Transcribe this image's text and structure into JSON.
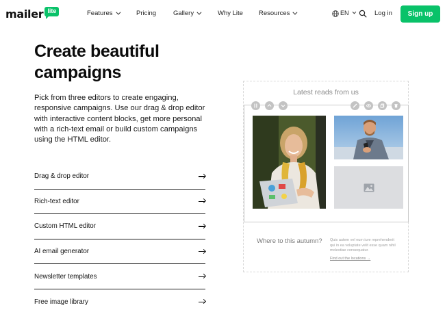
{
  "nav": {
    "logo_text": "mailer",
    "logo_badge": "lite",
    "items": [
      {
        "label": "Features",
        "has_dropdown": true
      },
      {
        "label": "Pricing",
        "has_dropdown": false
      },
      {
        "label": "Gallery",
        "has_dropdown": true
      },
      {
        "label": "Why Lite",
        "has_dropdown": false
      },
      {
        "label": "Resources",
        "has_dropdown": true
      }
    ],
    "language": "EN",
    "login_label": "Log in",
    "signup_label": "Sign up"
  },
  "hero": {
    "title": "Create beautiful campaigns",
    "description": "Pick from three editors to create engaging, responsive campaigns. Use our drag & drop editor with interactive content blocks, get more personal with a rich-text email or build custom campaigns using the HTML editor."
  },
  "features": [
    "Drag & drop editor",
    "Rich-text editor",
    "Custom HTML editor",
    "AI email generator",
    "Newsletter templates",
    "Free image library"
  ],
  "preview": {
    "heading": "Latest reads from us",
    "toolbar_left": [
      "drag-handle-icon",
      "move-up-icon",
      "move-down-icon"
    ],
    "toolbar_right": [
      "edit-icon",
      "preview-eye-icon",
      "duplicate-icon",
      "delete-icon"
    ],
    "teaser_title": "Where to this autumn?",
    "teaser_body": "Quis autem vel eum iure reprehenderit qui in ea voluptate velit esse quam nihil molestiae consequatur.",
    "teaser_link": "Find out the locations →"
  },
  "colors": {
    "brand_green": "#09c269",
    "text": "#0b0b0b",
    "muted": "#8a8a8a"
  }
}
